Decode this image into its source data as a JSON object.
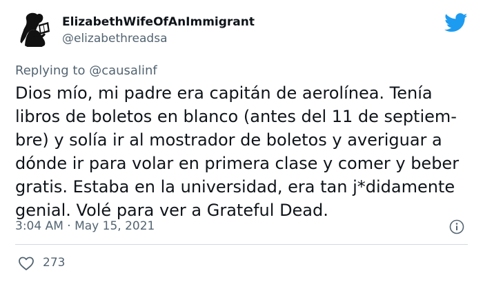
{
  "user": {
    "display_name": "ElizabethWifeOfAnImmigrant",
    "handle": "@elizabethreadsa"
  },
  "reply": {
    "prefix": "Replying to",
    "mention": "@causalinf"
  },
  "tweet": {
    "text": "Dios mío, mi padre era capitán de aerolínea. Tenía\nlibros de boletos en blanco (antes del 11 de septiem-\nbre) y solía ir al mostrador de boletos y averiguar a\ndónde ir para volar en primera clase y comer y beber\ngratis. Estaba en la universidad, era tan j*didamente\ngenial. Volé para ver a Grateful Dead.",
    "timestamp": "3:04 AM · May 15, 2021"
  },
  "engagement": {
    "likes": "273"
  },
  "icons": {
    "brand": "twitter-bird-icon",
    "info": "info-icon",
    "like": "heart-icon"
  },
  "colors": {
    "brand": "#1d9bf0",
    "text": "#0f1419",
    "muted": "#536471",
    "divider": "#cfd9de"
  }
}
